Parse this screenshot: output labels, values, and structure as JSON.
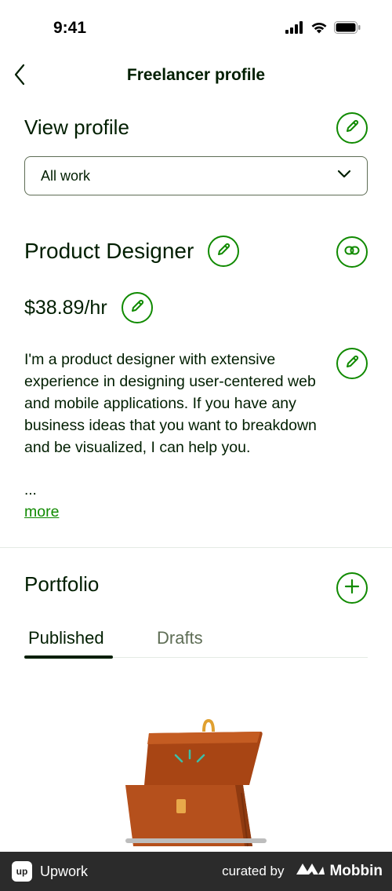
{
  "status_bar": {
    "time": "9:41",
    "icons": [
      "cellular-signal-icon",
      "wifi-icon",
      "battery-icon"
    ]
  },
  "nav": {
    "title": "Freelancer profile",
    "back_icon": "chevron-left-icon"
  },
  "view_profile": {
    "heading": "View profile",
    "edit_icon": "pencil-icon",
    "dropdown": {
      "selected": "All work",
      "icon": "chevron-down-icon"
    }
  },
  "profile": {
    "title": "Product Designer",
    "title_edit_icon": "pencil-icon",
    "share_icon": "link-icon",
    "rate": "$38.89/hr",
    "rate_edit_icon": "pencil-icon",
    "overview": "I'm a product designer with extensive experience in designing user-centered web and mobile applications. If you have any business ideas that you want to breakdown and be visualized, I can help you.",
    "overview_truncation": "...",
    "overview_edit_icon": "pencil-icon",
    "more_link": "more"
  },
  "portfolio": {
    "heading": "Portfolio",
    "add_icon": "plus-icon",
    "tabs": [
      {
        "label": "Published",
        "active": true
      },
      {
        "label": "Drafts",
        "active": false
      }
    ],
    "empty_illustration": "open-briefcase-illustration"
  },
  "footer": {
    "brand": "Upwork",
    "brand_logo_text": "up",
    "curated_label": "curated by",
    "curator": "Mobbin"
  },
  "colors": {
    "accent_green": "#108a00",
    "text_dark": "#001e00",
    "text_muted": "#5e6d55",
    "divider": "#e4ebe4",
    "footer_bg": "#2b2b2b",
    "briefcase_brown": "#b5501c"
  }
}
